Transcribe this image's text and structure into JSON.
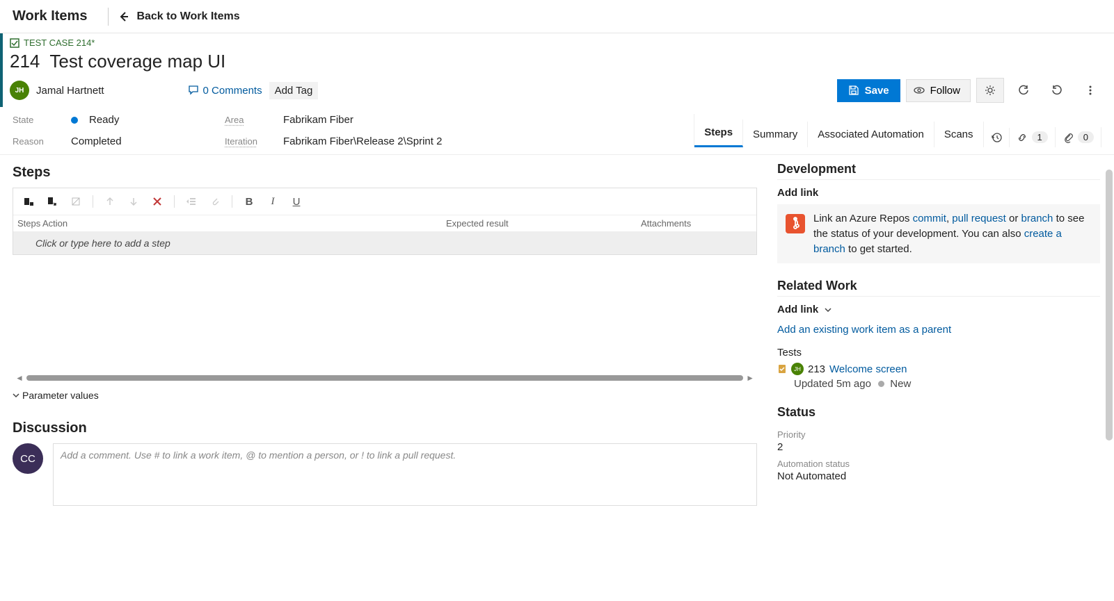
{
  "topbar": {
    "title": "Work Items",
    "back": "Back to Work Items"
  },
  "workitem": {
    "type_label": "TEST CASE 214*",
    "id": "214",
    "title": "Test coverage map UI",
    "assignee": "Jamal Hartnett",
    "assignee_initials": "JH",
    "comments": "0 Comments",
    "add_tag": "Add Tag"
  },
  "actions": {
    "save": "Save",
    "follow": "Follow"
  },
  "fields": {
    "state_label": "State",
    "state_value": "Ready",
    "reason_label": "Reason",
    "reason_value": "Completed",
    "area_label": "Area",
    "area_value": "Fabrikam Fiber",
    "iteration_label": "Iteration",
    "iteration_value": "Fabrikam Fiber\\Release 2\\Sprint 2"
  },
  "tabs": {
    "steps": "Steps",
    "summary": "Summary",
    "automation": "Associated Automation",
    "scans": "Scans",
    "links_count": "1",
    "attach_count": "0"
  },
  "steps": {
    "heading": "Steps",
    "col_steps": "Steps",
    "col_action": "Action",
    "col_expected": "Expected result",
    "col_attach": "Attachments",
    "placeholder": "Click or type here to add a step",
    "param_toggle": "Parameter values"
  },
  "discussion": {
    "heading": "Discussion",
    "avatar_initials": "CC",
    "placeholder": "Add a comment. Use # to link a work item, @ to mention a person, or ! to link a pull request."
  },
  "development": {
    "heading": "Development",
    "add_link": "Add link",
    "text_pre": "Link an Azure Repos ",
    "commit": "commit",
    "pr": "pull request",
    "or": " or ",
    "branch": "branch",
    "text_mid": " to see the status of your development. You can also ",
    "create_branch": "create a branch",
    "text_end": " to get started.",
    "comma": ", "
  },
  "related": {
    "heading": "Related Work",
    "add_link": "Add link",
    "parent_link": "Add an existing work item as a parent",
    "tests_label": "Tests",
    "test_id": "213",
    "test_title": "Welcome screen",
    "test_updated": "Updated 5m ago",
    "test_state": "New",
    "test_initials": "JH"
  },
  "status": {
    "heading": "Status",
    "priority_label": "Priority",
    "priority_value": "2",
    "automation_label": "Automation status",
    "automation_value": "Not Automated"
  }
}
